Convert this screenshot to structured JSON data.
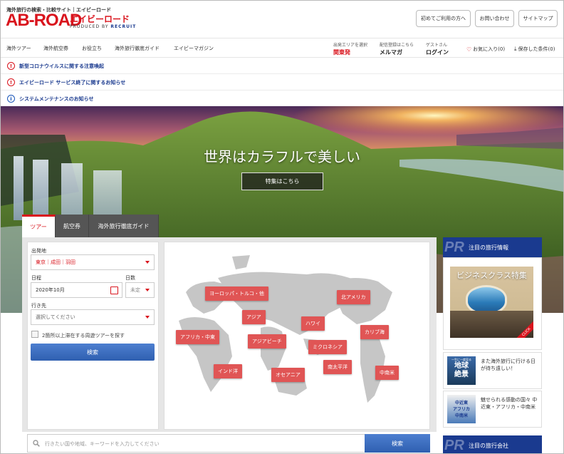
{
  "header": {
    "tagline": "海外旅行の検索・比較サイト｜エイビーロード",
    "logo": "AB-ROAD",
    "logo_kana": "エイビーロード",
    "produced_by": "PRODUCED BY",
    "brand": "RECRUIT",
    "buttons": [
      "初めてご利用の方へ",
      "お問い合わせ",
      "サイトマップ"
    ]
  },
  "gnav": {
    "items": [
      "海外ツアー",
      "海外航空券",
      "お役立ち",
      "海外旅行徹底ガイド",
      "エイビーマガジン"
    ],
    "departure_label": "出発エリアを選択",
    "departure_value": "関東発",
    "mail_label": "配信登録はこちら",
    "mail_value": "メルマガ",
    "guest_label": "ゲストさん",
    "guest_value": "ログイン",
    "favorites": "お気に入り(0)",
    "saved": "保存した条件(0)"
  },
  "notices": [
    {
      "text": "新型コロナウイルスに関する注意喚起",
      "type": "alert"
    },
    {
      "text": "エイビーロード サービス終了に関するお知らせ",
      "type": "alert"
    },
    {
      "text": "システムメンテナンスのお知らせ",
      "type": "info"
    }
  ],
  "hero": {
    "title": "世界はカラフルで美しい",
    "button": "特集はこちら"
  },
  "search": {
    "tabs": [
      "ツアー",
      "航空券",
      "海外旅行徹底ガイド"
    ],
    "departure_label": "出発地",
    "departure_value": "東京｜成田｜羽田",
    "date_label": "日程",
    "date_value": "2020年10月",
    "days_label": "日数",
    "days_value": "未定",
    "dest_label": "行き先",
    "dest_value": "選択してください",
    "multi_label": "2箇所以上滞在する周遊ツアーを探す",
    "search_button": "検索"
  },
  "regions": [
    "ヨーロッパ・トルコ・他",
    "北アメリカ",
    "アジア",
    "ハワイ",
    "カリブ海",
    "アフリカ・中東",
    "アジアビーチ",
    "ミクロネシア",
    "インド洋",
    "オセアニア",
    "南太平洋",
    "中南米"
  ],
  "keyword": {
    "placeholder": "行きたい国や地域、キーワードを入力してください",
    "button": "検索"
  },
  "sidebar": {
    "pr_label": "PR",
    "pr_title": "注目の旅行情報",
    "banner_title": "ビジネスクラス特集",
    "banner_click": "CLICK",
    "item1_thumb": [
      "地球",
      "絶景"
    ],
    "item1_thumb_small": "一生に一度見る",
    "item1_text": "また海外旅行に行ける日が待ち遠しい！",
    "item2_thumb": [
      "中近東",
      "アフリカ",
      "中南米"
    ],
    "item2_text": "魅せられる感動の国々 中近東・アフリカ・中南米",
    "pr2_title": "注目の旅行会社"
  },
  "colors": {
    "brand_red": "#d9141d",
    "brand_blue": "#1a3a8f",
    "region": "#e05555"
  }
}
